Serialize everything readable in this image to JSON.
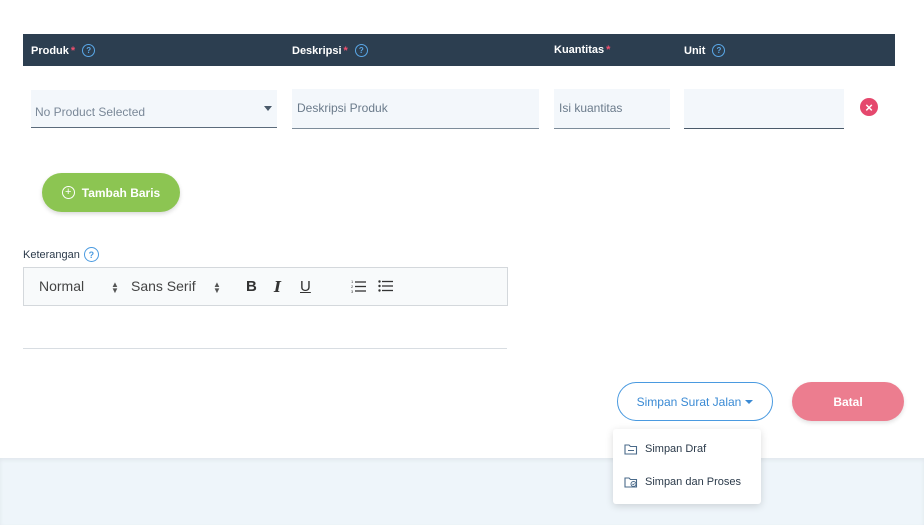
{
  "table": {
    "headers": {
      "produk": "Produk",
      "deskripsi": "Deskripsi",
      "kuantitas": "Kuantitas",
      "unit": "Unit",
      "required_mark": "*",
      "help_mark": "?"
    },
    "row": {
      "produk_value": "No Product Selected",
      "deskripsi_placeholder": "Deskripsi Produk",
      "kuantitas_placeholder": "Isi kuantitas",
      "unit_value": ""
    }
  },
  "add_row_button": {
    "label": "Tambah Baris",
    "icon": "plus-circle-icon"
  },
  "keterangan": {
    "label": "Keterangan",
    "help_mark": "?",
    "toolbar": {
      "format": "Normal",
      "font": "Sans Serif",
      "bold": "B",
      "italic": "I",
      "underline": "U"
    }
  },
  "actions": {
    "save_label": "Simpan Surat Jalan",
    "cancel_label": "Batal",
    "dropdown": [
      {
        "label": "Simpan Draf",
        "icon": "draft-folder-icon"
      },
      {
        "label": "Simpan dan Proses",
        "icon": "process-folder-icon"
      }
    ]
  },
  "colors": {
    "header_bg": "#2c3e50",
    "required": "#f0506e",
    "help": "#5aa8e8",
    "add_button": "#8cc552",
    "save_border": "#4a9ae0",
    "cancel_button": "#ec7d8f",
    "remove_icon": "#e5486d"
  }
}
